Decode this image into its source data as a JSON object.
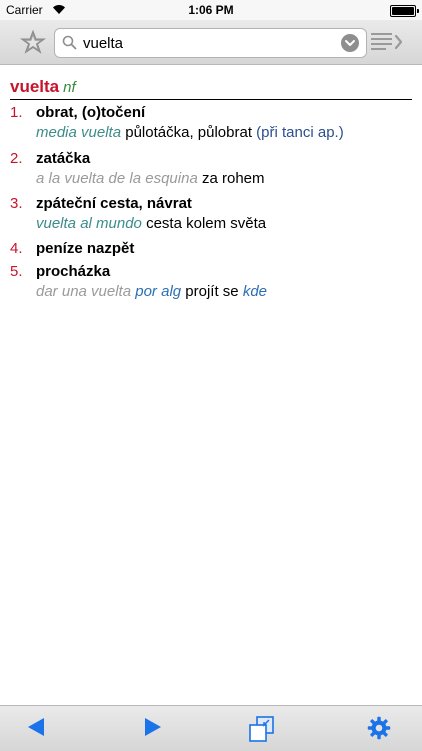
{
  "status": {
    "carrier": "Carrier",
    "time": "1:06 PM"
  },
  "search": {
    "value": "vuelta"
  },
  "entry": {
    "headword": "vuelta",
    "pos": "nf",
    "senses": [
      {
        "num": "1.",
        "translation": "obrat, (o)točení",
        "example": {
          "es": "media vuelta",
          "cz": "půlotáčka, půlobrat",
          "note": "(při tanci ap.)"
        }
      },
      {
        "num": "2.",
        "translation": "zatáčka",
        "example": {
          "es": "a la vuelta de la esquina",
          "cz": "za rohem"
        }
      },
      {
        "num": "3.",
        "translation": "zpáteční cesta, návrat",
        "example": {
          "es": "vuelta al mundo",
          "cz": "cesta kolem světa"
        }
      },
      {
        "num": "4.",
        "translation": "peníze nazpět"
      },
      {
        "num": "5.",
        "translation": "procházka",
        "example": {
          "es": "dar una vuelta",
          "es2": "por alg",
          "cz": "projít se",
          "es3": "kde"
        }
      }
    ]
  },
  "colors": {
    "headword": "#c8142b",
    "accent": "#1a73e8"
  },
  "icons": {
    "favorite": "star-icon",
    "search": "search-icon",
    "clear": "chevron-down-icon",
    "history": "list-arrow-icon",
    "back": "arrow-left-icon",
    "forward": "arrow-right-icon",
    "window": "window-swap-icon",
    "settings": "gear-icon"
  }
}
